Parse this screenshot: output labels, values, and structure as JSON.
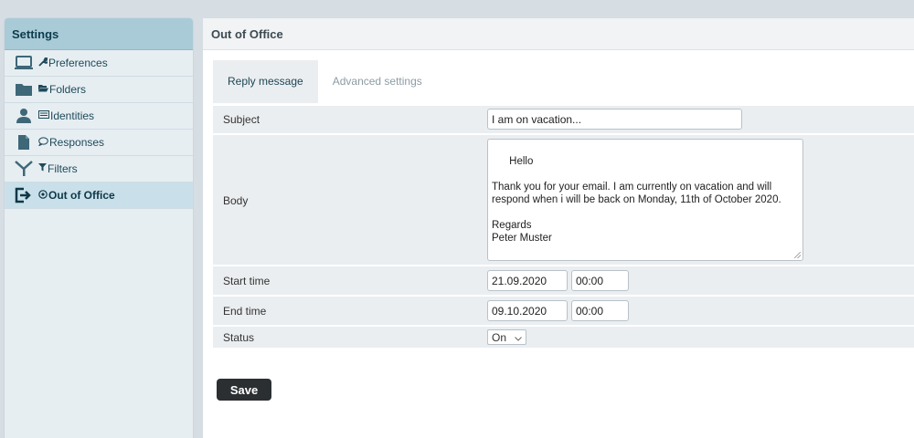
{
  "sidebar": {
    "title": "Settings",
    "items": [
      {
        "label": "Preferences",
        "icon": "laptop-icon",
        "small_icon": "wrench-icon",
        "small_glyph": "🔧",
        "active": false
      },
      {
        "label": "Folders",
        "icon": "folder-icon",
        "small_icon": "folder-open-icon",
        "small_glyph": "📂",
        "active": false
      },
      {
        "label": "Identities",
        "icon": "user-icon",
        "small_icon": "id-card-icon",
        "small_glyph": "▤",
        "active": false
      },
      {
        "label": "Responses",
        "icon": "document-icon",
        "small_icon": "speech-bubble-icon",
        "small_glyph": "💬",
        "active": false
      },
      {
        "label": "Filters",
        "icon": "filter-icon",
        "small_icon": "funnel-icon",
        "small_glyph": "▼",
        "active": false
      },
      {
        "label": "Out of Office",
        "icon": "sign-out-icon",
        "small_icon": "clock-icon",
        "small_glyph": "⊙",
        "active": true
      }
    ]
  },
  "main": {
    "title": "Out of Office",
    "tabs": [
      {
        "label": "Reply message",
        "active": true
      },
      {
        "label": "Advanced settings",
        "active": false
      }
    ],
    "form": {
      "subject_label": "Subject",
      "subject_value": "I am on vacation...",
      "body_label": "Body",
      "body_value": "Hello\n\nThank you for your email. I am currently on vacation and will respond when i will be back on Monday, 11th of October 2020.\n\nRegards\nPeter Muster",
      "start_label": "Start time",
      "start_date": "21.09.2020",
      "start_time": "00:00",
      "end_label": "End time",
      "end_date": "09.10.2020",
      "end_time": "00:00",
      "status_label": "Status",
      "status_value": "On"
    },
    "save_label": "Save"
  },
  "colors": {
    "sidebar_header": "#a9cbd8",
    "sidebar_bg": "#e6eef2",
    "active_item": "#c9e0ea",
    "save_button": "#2b2f31"
  }
}
